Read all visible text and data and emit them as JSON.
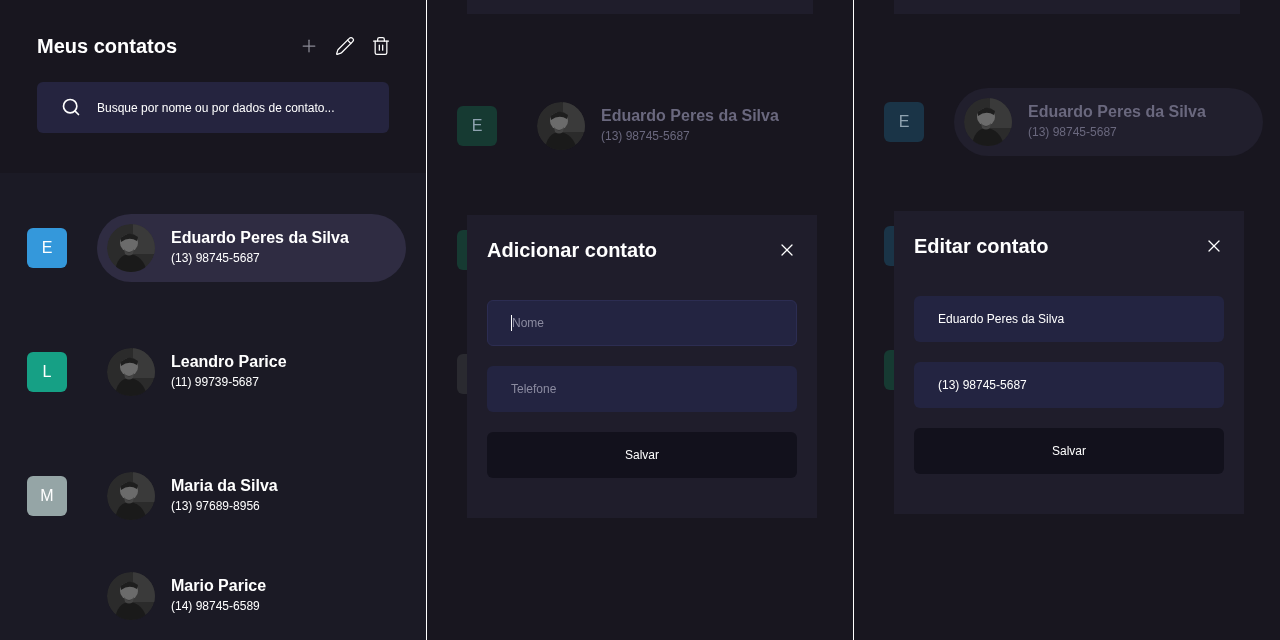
{
  "panels": [
    {
      "kind": "list",
      "title": "Meus contatos",
      "search": {
        "placeholder": "Busque por nome ou por dados de contato..."
      },
      "groups": [
        {
          "letter": "E",
          "color": "#3498db",
          "contacts": [
            {
              "name": "Eduardo Peres da Silva",
              "phone": "(13) 98745-5687",
              "selected": true
            }
          ]
        },
        {
          "letter": "L",
          "color": "#16a085",
          "contacts": [
            {
              "name": "Leandro Parice",
              "phone": "(11) 99739-5687",
              "selected": false
            }
          ]
        },
        {
          "letter": "M",
          "color": "#95a5a6",
          "contacts": [
            {
              "name": "Maria da Silva",
              "phone": "(13) 97689-8956",
              "selected": false
            },
            {
              "name": "Mario Parice",
              "phone": "(14) 98745-6589",
              "selected": false
            }
          ]
        }
      ]
    },
    {
      "kind": "modal",
      "background": {
        "groups": [
          {
            "letter": "E",
            "color": "#163a32",
            "contacts": [
              {
                "name": "Eduardo Peres da Silva",
                "phone": "(13) 98745-5687",
                "selected": false
              }
            ]
          },
          {
            "color": "#163a32"
          },
          {
            "color": "#2a2a30"
          }
        ]
      },
      "modal": {
        "title": "Adicionar contato",
        "fields": [
          {
            "placeholder": "Nome",
            "focused": true
          },
          {
            "placeholder": "Telefone",
            "focused": false
          }
        ],
        "button": "Salvar"
      }
    },
    {
      "kind": "modal",
      "background": {
        "groups": [
          {
            "letter": "E",
            "color": "#1a3447",
            "contacts": [
              {
                "name": "Eduardo Peres da Silva",
                "phone": "(13) 98745-5687",
                "selected": true
              }
            ]
          },
          {
            "color": "#1a3447"
          },
          {
            "color": "#163a32"
          }
        ]
      },
      "modal": {
        "title": "Editar contato",
        "fields": [
          {
            "value": "Eduardo Peres da Silva",
            "focused": false
          },
          {
            "value": "(13) 98745-5687",
            "focused": false
          }
        ],
        "button": "Salvar"
      }
    }
  ]
}
